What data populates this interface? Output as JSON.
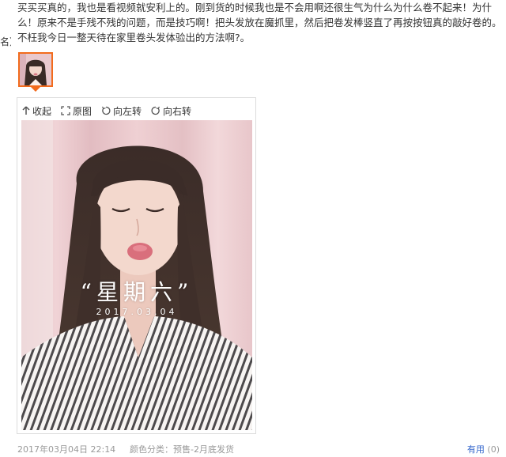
{
  "side_fragment": "名）",
  "review": {
    "text": "买买买真的，我也是看视频就安利上的。刚到货的时候我也是不会用啊还很生气为什么为什么卷不起来！为什么！原来不是手残不残的问题，而是技巧啊！把头发放在魔抓里，然后把卷发棒竖直了再按按钮真的敲好卷的。不枉我今日一整天待在家里卷头发体验出的方法啊?。"
  },
  "viewer": {
    "collapse_label": "收起",
    "original_label": "原图",
    "rotate_left_label": "向左转",
    "rotate_right_label": "向右转"
  },
  "photo": {
    "caption": "“星期六”",
    "date": "2017.03.04"
  },
  "footer": {
    "date": "2017年03月04日 22:14",
    "variant": "颜色分类：预售-2月底发货",
    "useful_label": "有用",
    "useful_count": "(0)"
  },
  "colors": {
    "accent_border": "#f26b1d",
    "link": "#3366cc",
    "meta_text": "#999999"
  },
  "icons": [
    "collapse-arrow-icon",
    "fullsize-icon",
    "rotate-left-icon",
    "rotate-right-icon"
  ]
}
